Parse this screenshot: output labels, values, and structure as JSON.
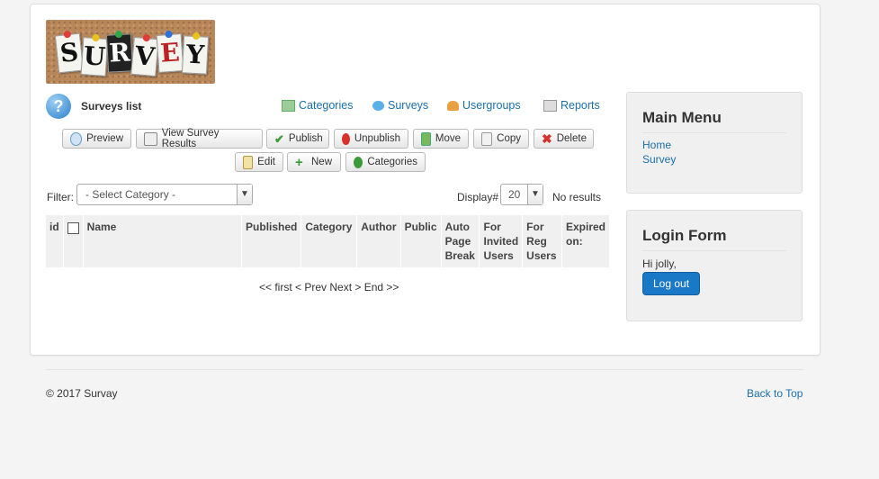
{
  "logo": {
    "letters": [
      "S",
      "U",
      "R",
      "V",
      "E",
      "Y"
    ],
    "alt": "Survey logo"
  },
  "page": {
    "title": "Surveys list"
  },
  "topnav": [
    {
      "label": "Categories",
      "icon": "categories-icon"
    },
    {
      "label": "Surveys",
      "icon": "surveys-icon"
    },
    {
      "label": "Usergroups",
      "icon": "usergroups-icon"
    },
    {
      "label": "Reports",
      "icon": "reports-icon"
    }
  ],
  "toolbar": {
    "preview": "Preview",
    "view_results": "View Survey Results",
    "publish": "Publish",
    "unpublish": "Unpublish",
    "move": "Move",
    "copy": "Copy",
    "delete": "Delete",
    "edit": "Edit",
    "new": "New",
    "categories": "Categories"
  },
  "filter": {
    "label": "Filter:",
    "category_value": "- Select Category -"
  },
  "display": {
    "label": "Display#",
    "value": "20",
    "no_results": "No results"
  },
  "table": {
    "columns": {
      "id": "id",
      "name": "Name",
      "published": "Published",
      "category": "Category",
      "author": "Author",
      "public": "Public",
      "auto_page_break": [
        "Auto",
        "Page",
        "Break"
      ],
      "for_invited": [
        "For",
        "Invited",
        "Users"
      ],
      "for_reg": [
        "For",
        "Reg",
        "Users"
      ],
      "expired": [
        "Expired",
        "on:"
      ]
    }
  },
  "pager": {
    "text": "<< first < Prev Next > End >>"
  },
  "main_menu": {
    "title": "Main Menu",
    "items": [
      "Home",
      "Survey"
    ]
  },
  "login": {
    "title": "Login Form",
    "greeting": "Hi jolly,",
    "logout": "Log out"
  },
  "footer": {
    "copyright": "© 2017 Survay",
    "back_to_top": "Back to Top"
  },
  "colors": {
    "link": "#1a6faa",
    "primary_button": "#1a79c6",
    "delete_icon": "#d9302c"
  }
}
